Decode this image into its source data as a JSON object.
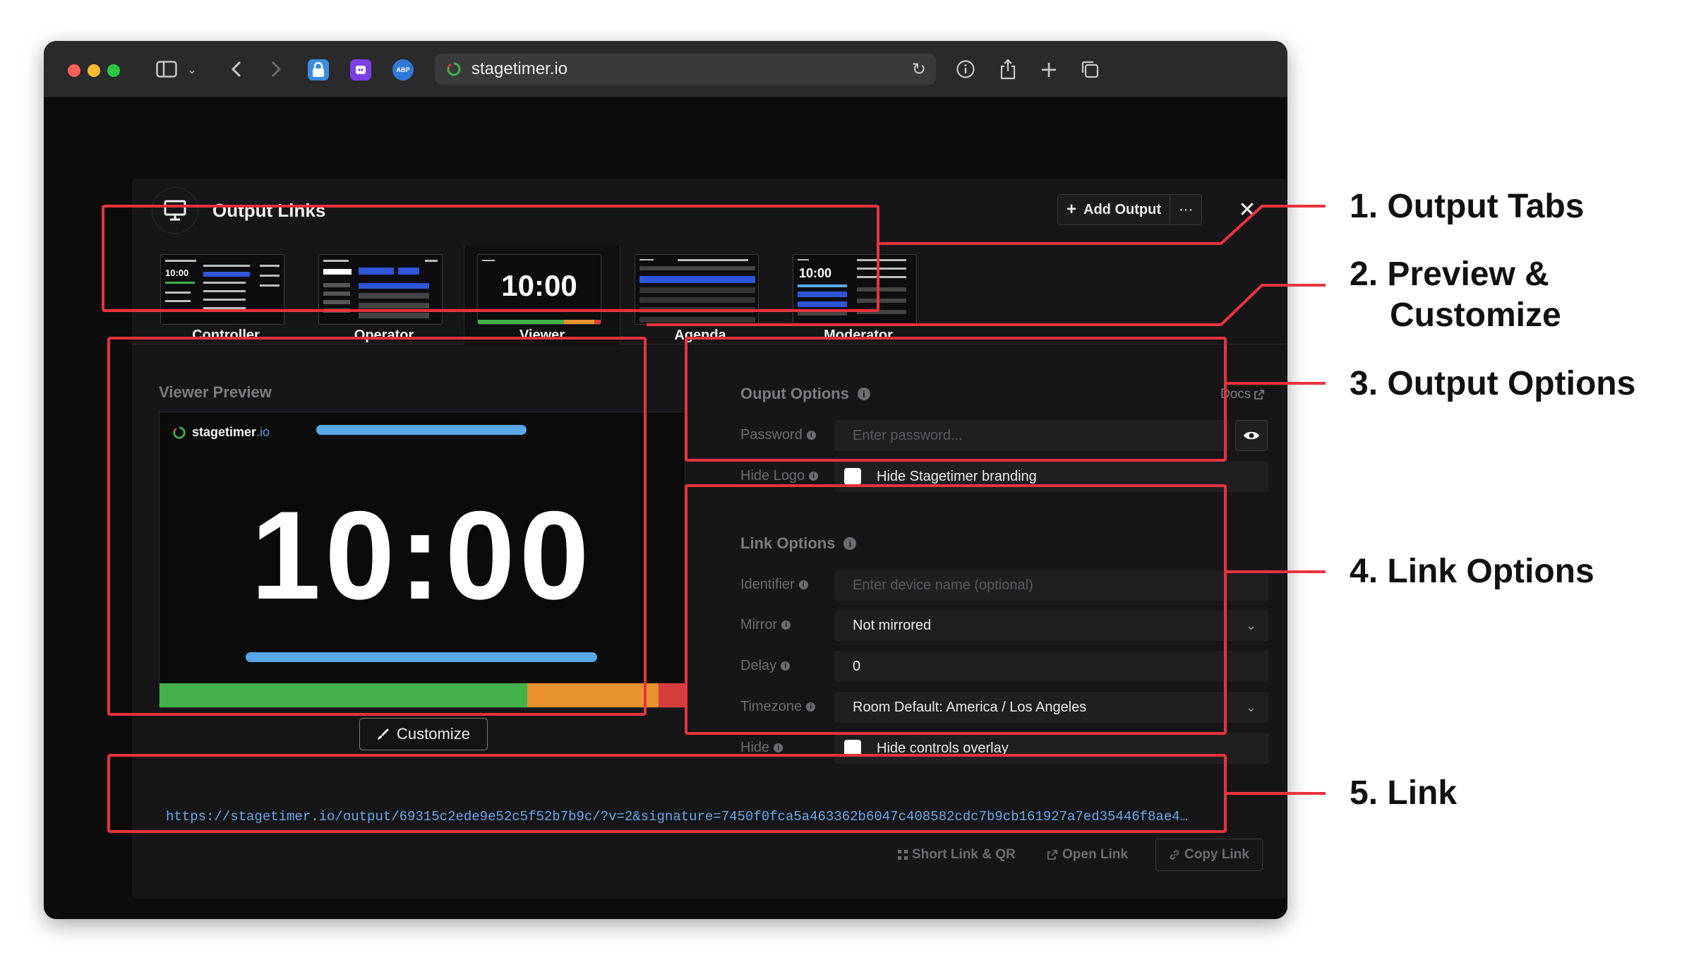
{
  "browser": {
    "url": "stagetimer.io"
  },
  "modal": {
    "title": "Output Links",
    "add_output_label": "Add Output",
    "more_label": "···",
    "close_label": "✕"
  },
  "tabs": [
    {
      "label": "Controller",
      "time": "10:00"
    },
    {
      "label": "Operator"
    },
    {
      "label": "Viewer",
      "time": "10:00"
    },
    {
      "label": "Agenda"
    },
    {
      "label": "Moderator",
      "time": "10:00"
    }
  ],
  "preview": {
    "label": "Viewer Preview",
    "brand_name": "stagetimer",
    "brand_io": ".io",
    "time": "10:00",
    "customize_label": "Customize",
    "strip_colors": [
      "#43b049",
      "#e8922e",
      "#d63e3e"
    ],
    "strip_fractions": [
      0.7,
      0.25,
      0.05
    ]
  },
  "output_options": {
    "title": "Ouput Options",
    "docs_label": "Docs",
    "password_label": "Password",
    "password_placeholder": "Enter password...",
    "hide_logo_label": "Hide Logo",
    "hide_logo_text": "Hide Stagetimer branding"
  },
  "link_options": {
    "title": "Link Options",
    "identifier_label": "Identifier",
    "identifier_placeholder": "Enter device name (optional)",
    "mirror_label": "Mirror",
    "mirror_value": "Not mirrored",
    "delay_label": "Delay",
    "delay_value": "0",
    "timezone_label": "Timezone",
    "timezone_value": "Room Default: America / Los Angeles",
    "hide_label": "Hide",
    "hide_text": "Hide controls overlay"
  },
  "link": {
    "url": "https://stagetimer.io/output/69315c2ede9e52c5f52b7b9c/?v=2&signature=7450f0fca5a463362b6047c408582cdc7b9cb161927a7ed35446f8ae4…",
    "short_link_label": "Short Link & QR",
    "open_link_label": "Open Link",
    "copy_link_label": "Copy Link"
  },
  "annotations": [
    {
      "lines": [
        "1. Output Tabs"
      ]
    },
    {
      "lines": [
        "2. Preview &",
        "Customize"
      ]
    },
    {
      "lines": [
        "3. Output Options"
      ]
    },
    {
      "lines": [
        "4. Link Options"
      ]
    },
    {
      "lines": [
        "5. Link"
      ]
    }
  ],
  "colors": {
    "accent_red": "#e8333d",
    "link_blue": "#6aa9ec",
    "bar_blue": "#58a8e8"
  }
}
